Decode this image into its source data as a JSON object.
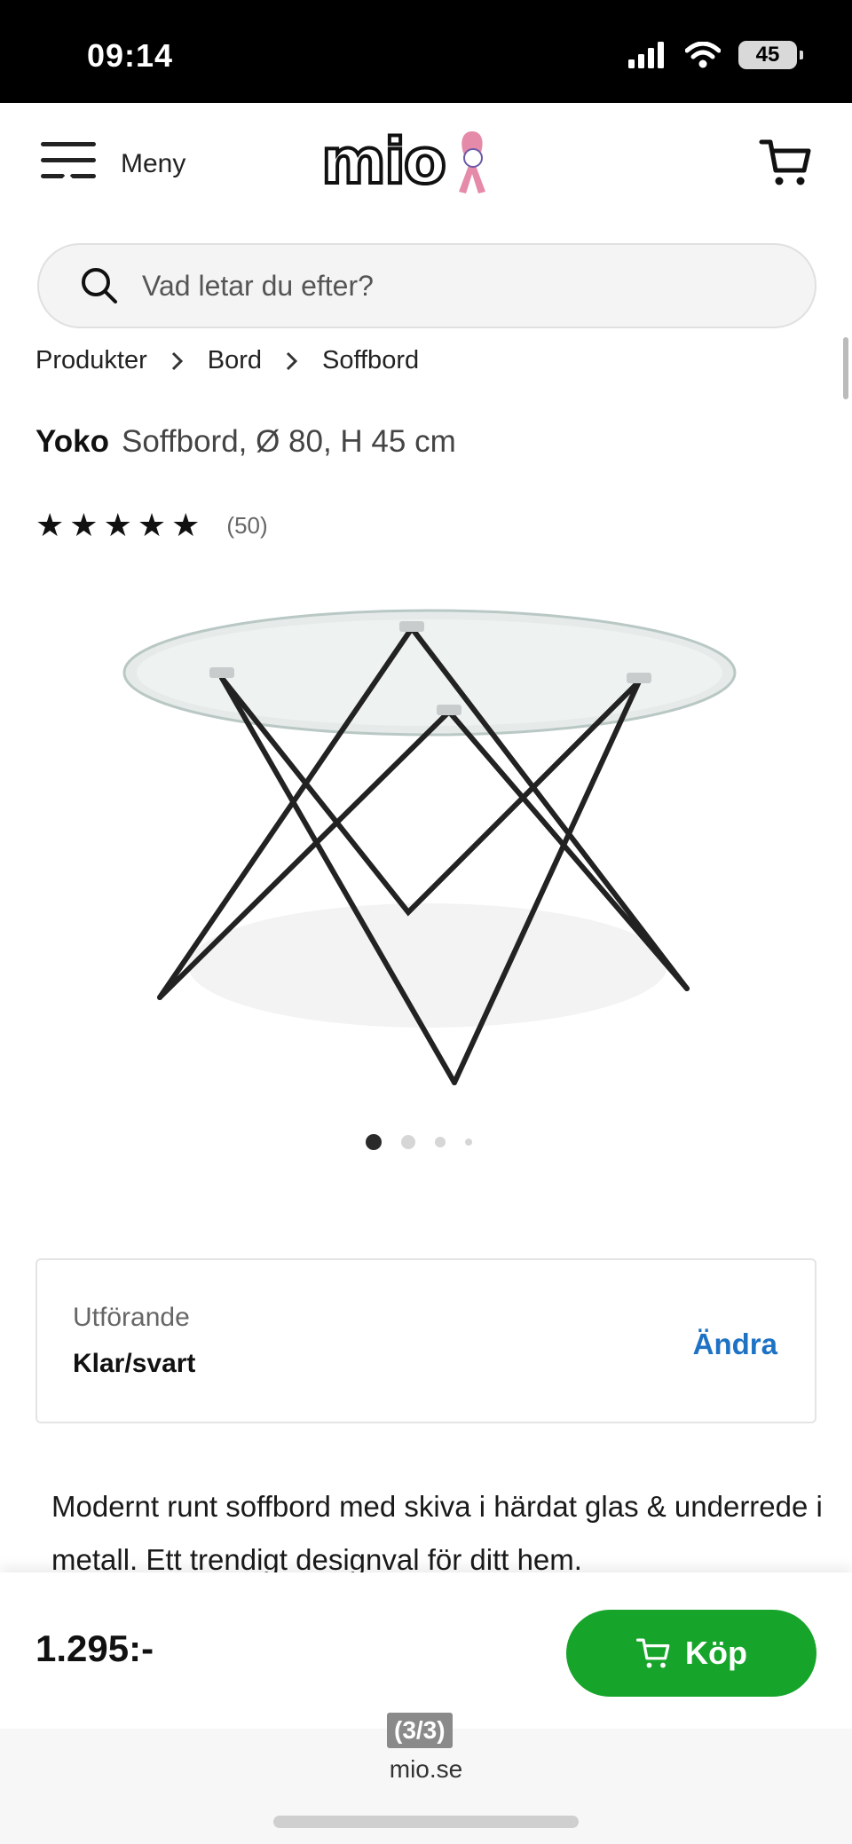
{
  "status_bar": {
    "time": "09:14",
    "battery": "45"
  },
  "header": {
    "menu_label": "Meny",
    "logo_text": "mio"
  },
  "search": {
    "placeholder": "Vad letar du efter?"
  },
  "breadcrumb": [
    "Produkter",
    "Bord",
    "Soffbord"
  ],
  "product": {
    "brand": "Yoko",
    "subtitle": "Soffbord, Ø 80, H 45 cm",
    "rating": 5,
    "review_count": "(50)",
    "image_index": 1,
    "image_total": 4
  },
  "variant": {
    "label": "Utförande",
    "value": "Klar/svart",
    "change_label": "Ändra"
  },
  "description": "Modernt runt soffbord med skiva i härdat glas & underrede i metall. Ett trendigt designval för ditt hem.",
  "buy_bar": {
    "price": "1.295:-",
    "buy_label": "Köp"
  },
  "browser": {
    "page_counter": "(3/3)",
    "domain": "mio.se"
  },
  "colors": {
    "buy_green": "#16a52a",
    "link_blue": "#1e72c4",
    "logo_pink": "#e58aa8"
  },
  "icons": [
    "hamburger-menu-icon",
    "cart-icon",
    "search-icon",
    "chevron-right-icon",
    "star-icon",
    "signal-icon",
    "wifi-icon",
    "battery-icon"
  ]
}
